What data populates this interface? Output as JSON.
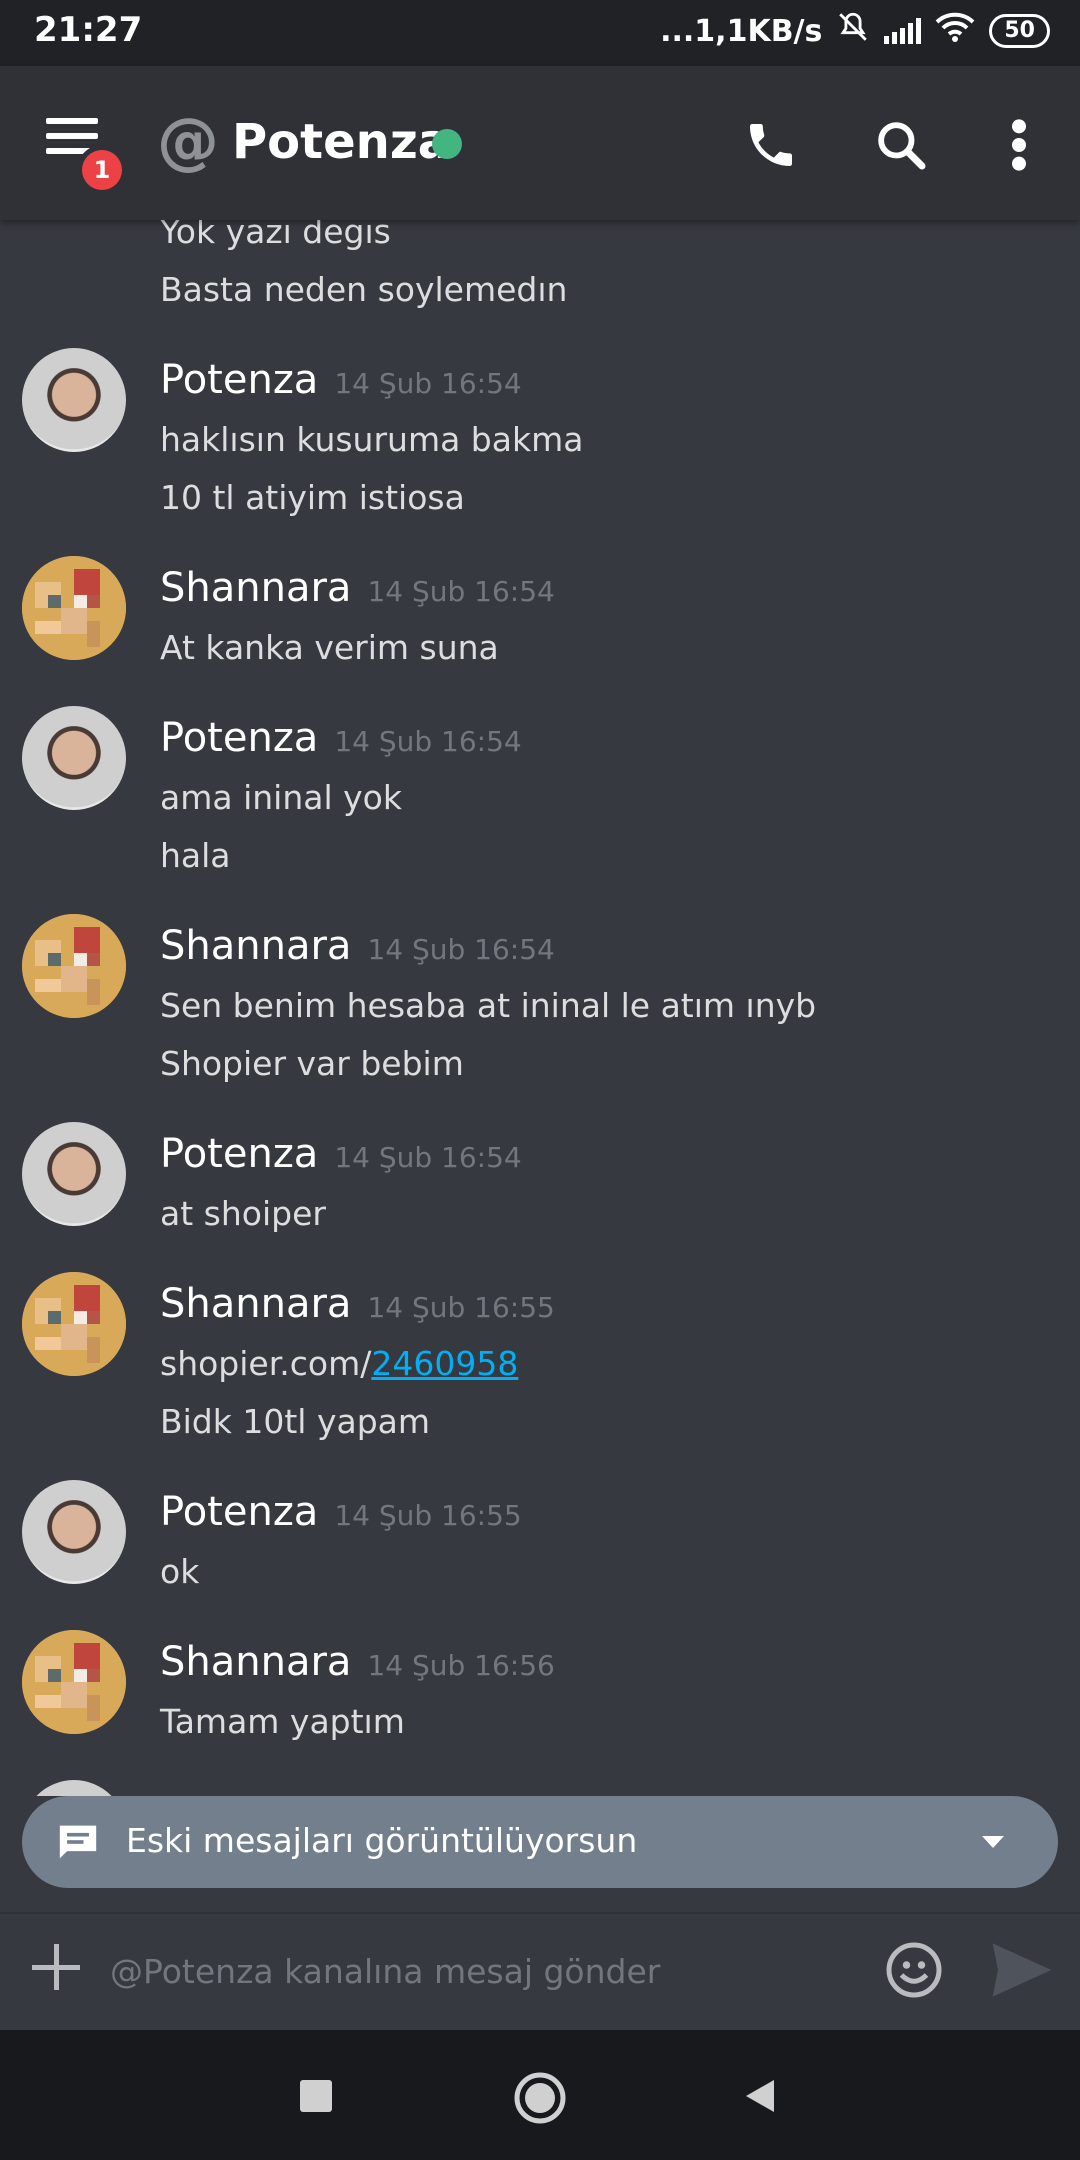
{
  "status_bar": {
    "time": "21:27",
    "net_speed": "...1,1KB/s",
    "battery": "50"
  },
  "header": {
    "unread_badge": "1",
    "at_symbol": "@",
    "channel_name": "Potenza",
    "presence_color": "#43b581"
  },
  "messages": [
    {
      "lines": [
        "Yok yazı degıs",
        "Basta neden soylemedın"
      ]
    },
    {
      "author": "Potenza",
      "time": "14 Şub 16:54",
      "lines": [
        "haklısın kusuruma bakma",
        "10 tl atiyim istiosa"
      ]
    },
    {
      "author": "Shannara",
      "time": "14 Şub 16:54",
      "lines": [
        "At kanka verim suna"
      ]
    },
    {
      "author": "Potenza",
      "time": "14 Şub 16:54",
      "lines": [
        "ama ininal yok",
        "hala"
      ]
    },
    {
      "author": "Shannara",
      "time": "14 Şub 16:54",
      "lines": [
        "Sen benim hesaba at ininal le atım ınyb",
        "Shopier var bebim"
      ]
    },
    {
      "author": "Potenza",
      "time": "14 Şub 16:54",
      "lines": [
        "at shoiper"
      ]
    },
    {
      "author": "Shannara",
      "time": "14 Şub 16:55",
      "link_prefix": "shopier.com/",
      "link_text": "2460958",
      "lines": [
        "Bidk 10tl yapam"
      ]
    },
    {
      "author": "Potenza",
      "time": "14 Şub 16:55",
      "lines": [
        "ok"
      ]
    },
    {
      "author": "Shannara",
      "time": "14 Şub 16:56",
      "lines": [
        "Tamam yaptım"
      ]
    }
  ],
  "banner": {
    "text": "Eski mesajları görüntülüyorsun"
  },
  "composer": {
    "placeholder": "@Potenza kanalına mesaj gönder"
  },
  "icons": {
    "menu": "menu-icon",
    "call": "phone-icon",
    "search": "search-icon",
    "more": "more-vertical-icon",
    "attach": "plus-icon",
    "emoji": "emoji-icon",
    "send": "send-icon",
    "banner": "chat-bubble-icon",
    "banner_toggle": "caret-down-icon",
    "nav": [
      "square-icon",
      "circle-icon",
      "back-triangle-icon"
    ]
  },
  "colors": {
    "background": "#36393f",
    "header": "#2f3136",
    "link": "#00aff4",
    "badge": "#ed4245",
    "banner": "#747f8d"
  }
}
